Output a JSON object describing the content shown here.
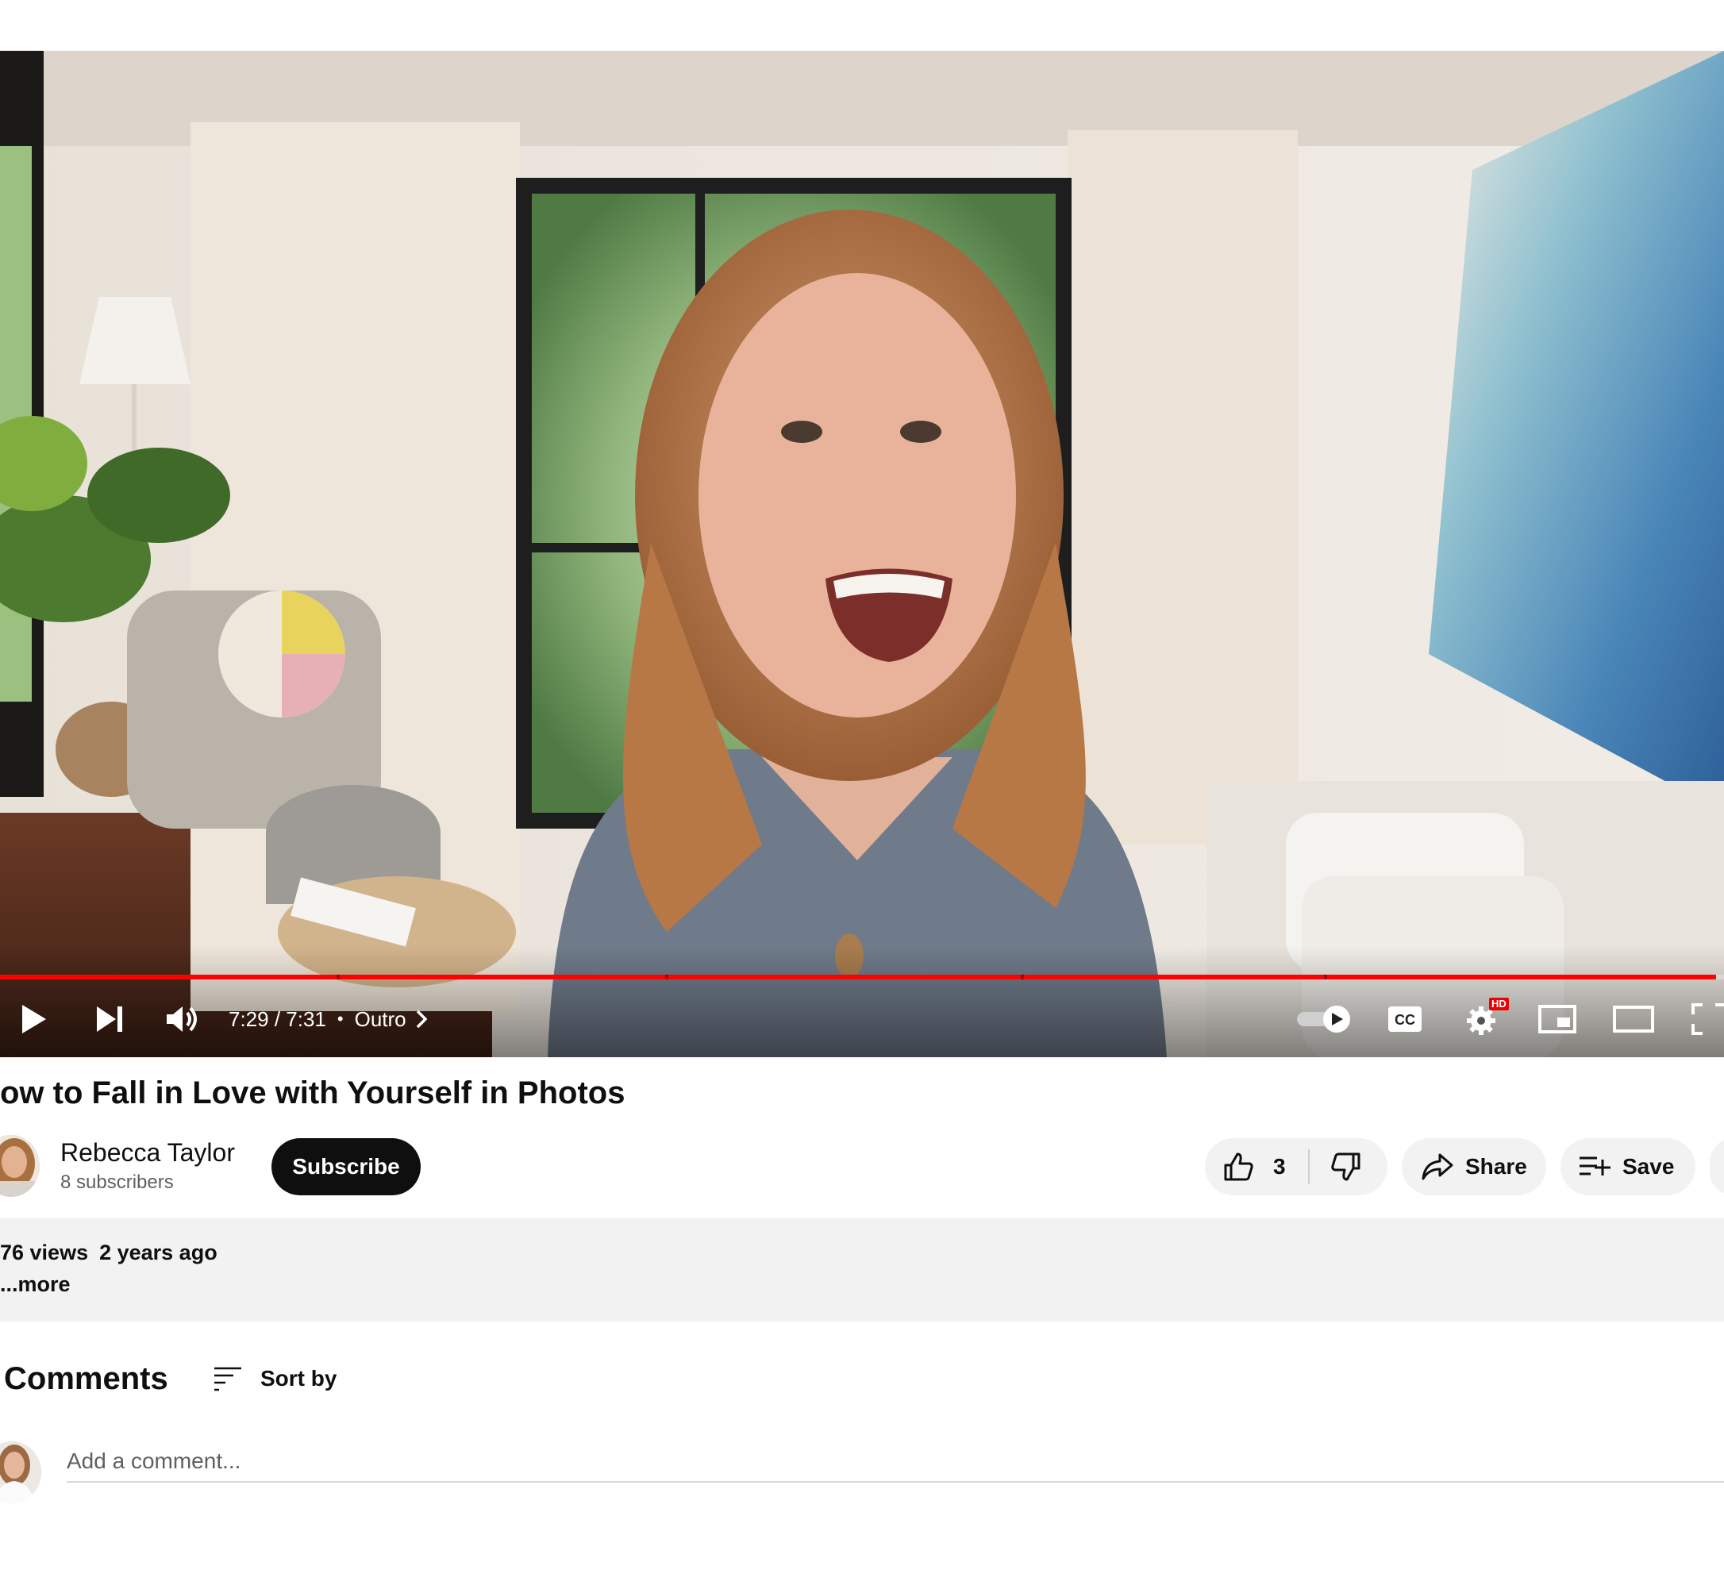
{
  "player": {
    "time_display": "7:29 / 7:31",
    "separator": "•",
    "chapter": "Outro",
    "progress_fraction": 0.9956,
    "hd_badge": "HD",
    "autoplay_on": true,
    "colors": {
      "progress": "#ff0000"
    }
  },
  "video": {
    "title": "ow to Fall in Love with Yourself in Photos"
  },
  "channel": {
    "name": "Rebecca Taylor",
    "subscribers": "8 subscribers",
    "subscribe_label": "Subscribe"
  },
  "actions": {
    "like_count": "3",
    "share_label": "Share",
    "save_label": "Save"
  },
  "description": {
    "views": "76 views",
    "ago": "2 years ago",
    "more": "...more"
  },
  "comments": {
    "heading": "Comments",
    "sort_label": "Sort by",
    "placeholder": "Add a comment..."
  },
  "icons": [
    "play-icon",
    "next-icon",
    "volume-icon",
    "chevron-right-icon",
    "autoplay-toggle-icon",
    "cc-icon",
    "settings-icon",
    "miniplayer-icon",
    "theater-icon",
    "fullscreen-icon",
    "thumbs-up-icon",
    "thumbs-down-icon",
    "share-icon",
    "save-playlist-icon",
    "sort-icon"
  ]
}
